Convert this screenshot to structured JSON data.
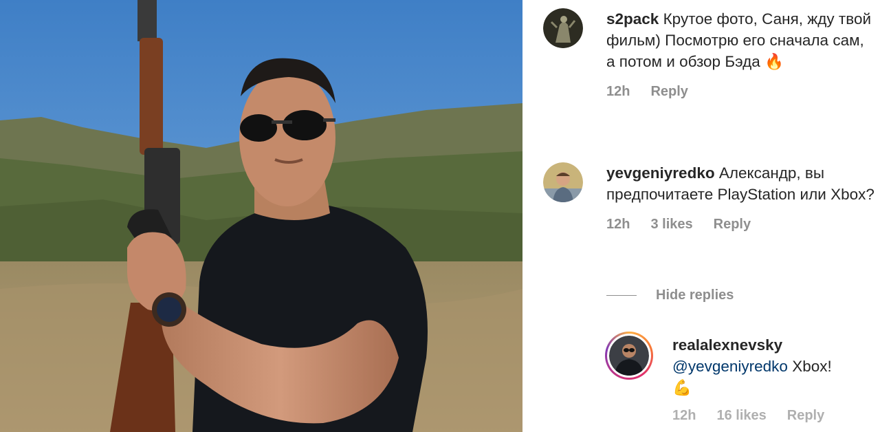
{
  "comments": [
    {
      "username": "s2pack",
      "text": "Крутое фото, Саня, жду твой фильм) Посмотрю его сначала сам, а потом и обзор Бэда",
      "emoji": "🔥",
      "time": "12h",
      "reply_label": "Reply"
    },
    {
      "username": "yevgeniyredko",
      "text": "Александр, вы предпочитаете PlayStation или Xbox?",
      "time": "12h",
      "likes": "3 likes",
      "reply_label": "Reply"
    }
  ],
  "hide_replies_label": "Hide replies",
  "reply": {
    "username": "realalexnevsky",
    "mention": "@yevgeniyredko",
    "text": "Xbox!",
    "emoji": "💪",
    "time": "12h",
    "likes": "16 likes",
    "reply_label": "Reply"
  },
  "icons": {
    "fire": "fire-emoji",
    "flexed_biceps": "flexed-biceps-emoji"
  },
  "colors": {
    "text": "#262626",
    "meta": "#8e8e8e",
    "mention": "#00376b",
    "sky": "#4a86c8"
  }
}
